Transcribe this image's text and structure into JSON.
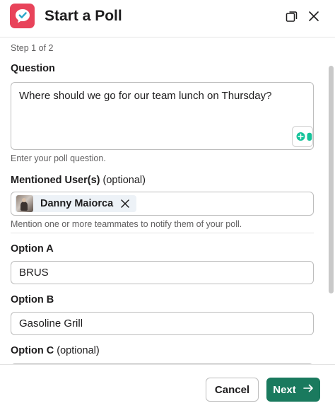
{
  "header": {
    "title": "Start a Poll",
    "logo_icon": "poll-checkmark-speech-bubble-icon",
    "expand_icon": "expand-window-icon",
    "close_icon": "close-icon"
  },
  "form": {
    "step_text": "Step 1 of 2",
    "question": {
      "label": "Question",
      "value": "Where should we go for our team lunch on Thursday?",
      "hint": "Enter your poll question."
    },
    "mentioned_users": {
      "label": "Mentioned User(s)",
      "optional": "(optional)",
      "chips": [
        {
          "name": "Danny Maiorca"
        }
      ],
      "hint": "Mention one or more teammates to notify them of your poll."
    },
    "option_a": {
      "label": "Option A",
      "value": "BRUS"
    },
    "option_b": {
      "label": "Option B",
      "value": "Gasoline Grill"
    },
    "option_c": {
      "label": "Option C",
      "optional": "(optional)"
    }
  },
  "footer": {
    "cancel_label": "Cancel",
    "next_label": "Next",
    "next_icon": "arrow-right-icon"
  },
  "colors": {
    "brand": "#e8435a",
    "primary_button": "#1a7a5e",
    "chip_background": "#edf2f7"
  }
}
